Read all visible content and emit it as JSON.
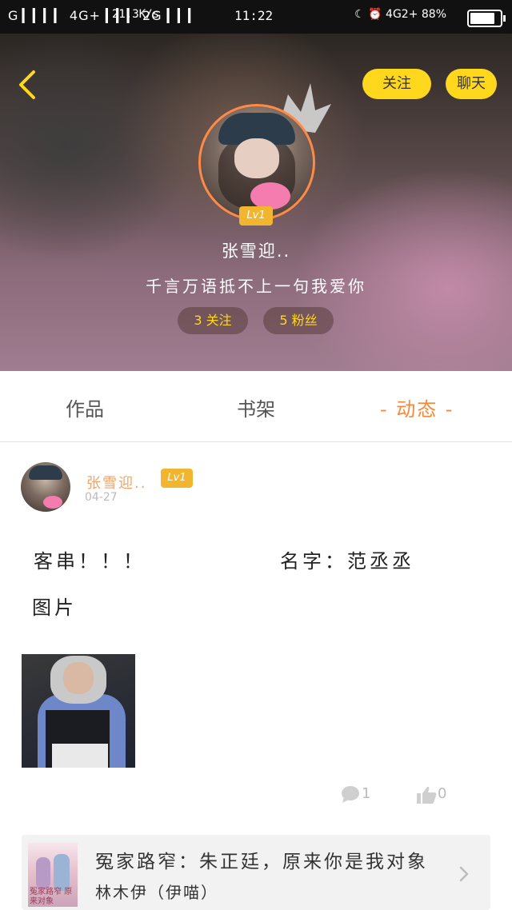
{
  "status_bar": {
    "left": "G ▎▎▎▎ 4G+ ▎▎▎ 2G ▎▎▎",
    "speed": "21.3K/s",
    "time": "11:22",
    "right": "☾ ⏰ 4G2+ 88%",
    "battery_level": 0.88
  },
  "header": {
    "follow_label": "关注",
    "chat_label": "聊天"
  },
  "profile": {
    "level": "Lv1",
    "username": "张雪迎..",
    "bio": "千言万语抵不上一句我爱你",
    "following": "3 关注",
    "fans": "5 粉丝"
  },
  "tabs": {
    "works": "作品",
    "shelf": "书架",
    "feed": "- 动态 -"
  },
  "post": {
    "author": "张雪迎..",
    "level": "Lv1",
    "date": "04-27",
    "line1_left": "客串！！！",
    "line1_right": "名字：范丞丞",
    "line2": "图片",
    "comment_count": "1",
    "like_count": "0"
  },
  "book_card": {
    "title": "冤家路窄：朱正廷，原来你是我对象",
    "author": "林木伊（伊喵）",
    "cover_text": "冤家路窄 原来对象"
  },
  "colors": {
    "accent_yellow": "#ffd81d",
    "accent_orange": "#f5893b",
    "level_badge": "#f2b530"
  }
}
